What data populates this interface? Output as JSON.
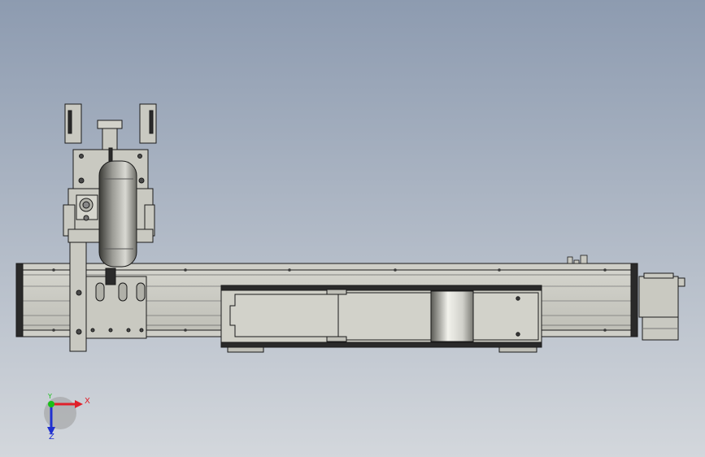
{
  "viewport": {
    "background_top": "#8d9bb0",
    "background_bottom": "#d3d7dc"
  },
  "model": {
    "body_color": "#c9c9c1",
    "edge_color": "#1a1a1a",
    "slider_color": "#cfcfc6",
    "wheel_shade": "#8a8a84"
  },
  "triad": {
    "x_label": "X",
    "y_label": "Y",
    "z_label": "Z",
    "x_color": "#e0202a",
    "y_color": "#18c018",
    "z_color": "#2030d0"
  }
}
